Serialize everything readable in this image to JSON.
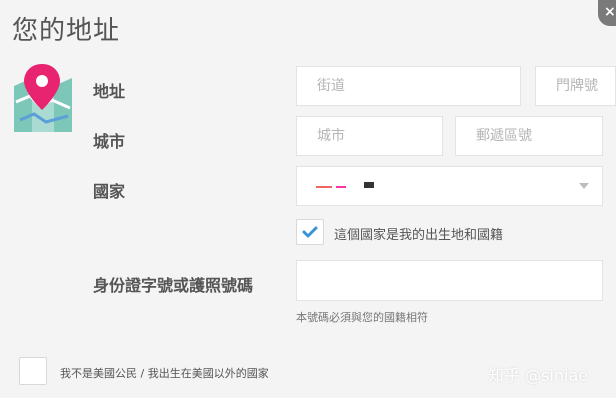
{
  "page": {
    "title": "您的地址"
  },
  "close": {
    "glyph": "×"
  },
  "labels": {
    "address": "地址",
    "city": "城市",
    "country": "國家",
    "id": "身份證字號或護照號碼"
  },
  "fields": {
    "street_placeholder": "街道",
    "number_placeholder": "門牌號",
    "city_placeholder": "城市",
    "postal_placeholder": "郵遞區號",
    "country_value": "",
    "id_value": ""
  },
  "birth_country_checkbox": {
    "checked": true,
    "label": "這個國家是我的出生地和國籍"
  },
  "id_hint": "本號碼必須與您的國籍相符",
  "non_us_checkbox": {
    "checked": false,
    "label": "我不是美國公民 / 我出生在美國以外的國家"
  },
  "watermark": "知乎 @siniae",
  "colors": {
    "accent": "#3a93d6",
    "pin": "#e8236f"
  }
}
